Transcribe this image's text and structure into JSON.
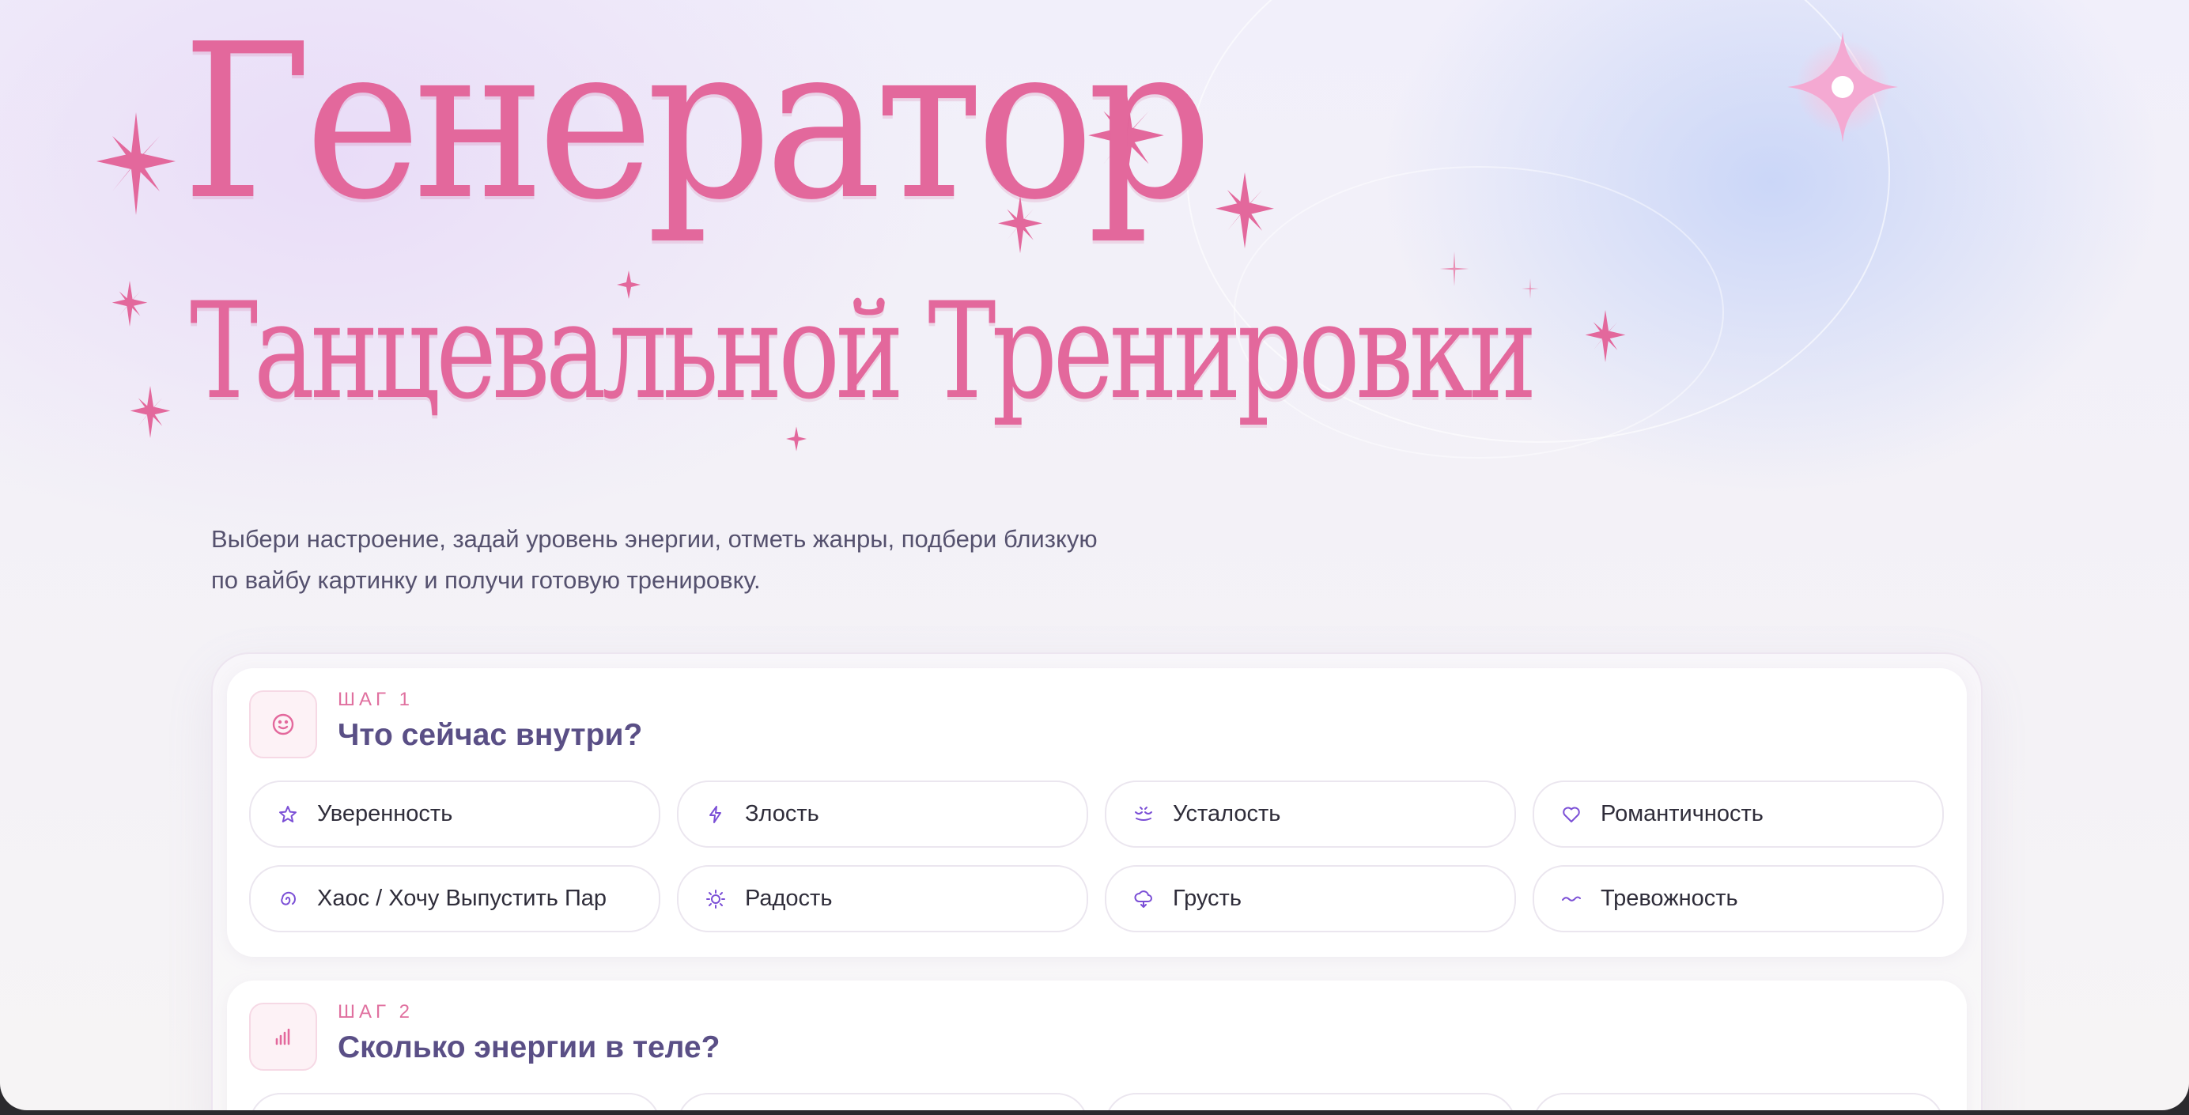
{
  "hero": {
    "title_line1": "Генератор",
    "title_line2": "Танцевальной Тренировки",
    "subtitle_line1": "Выбери настроение, задай уровень энергии, отметь жанры, подбери близкую",
    "subtitle_line2": "по вайбу картинку и получи готовую тренировку."
  },
  "colors": {
    "accent_pink": "#e3689c",
    "heading_purple": "#5a4f86",
    "icon_purple": "#7b4fd6"
  },
  "steps": [
    {
      "label": "ШАГ 1",
      "title": "Что сейчас внутри?",
      "icon": "smile-icon",
      "options": [
        {
          "label": "Уверенность",
          "icon": "star-icon"
        },
        {
          "label": "Злость",
          "icon": "lightning-icon"
        },
        {
          "label": "Усталость",
          "icon": "closed-eyes-icon"
        },
        {
          "label": "Романтичность",
          "icon": "heart-icon"
        },
        {
          "label": "Хаос / Хочу Выпустить Пар",
          "icon": "spiral-icon"
        },
        {
          "label": "Радость",
          "icon": "sun-icon"
        },
        {
          "label": "Грусть",
          "icon": "rain-cloud-icon"
        },
        {
          "label": "Тревожность",
          "icon": "wave-icon"
        }
      ]
    },
    {
      "label": "ШАГ 2",
      "title": "Сколько энергии в теле?",
      "icon": "bar-chart-icon"
    }
  ]
}
